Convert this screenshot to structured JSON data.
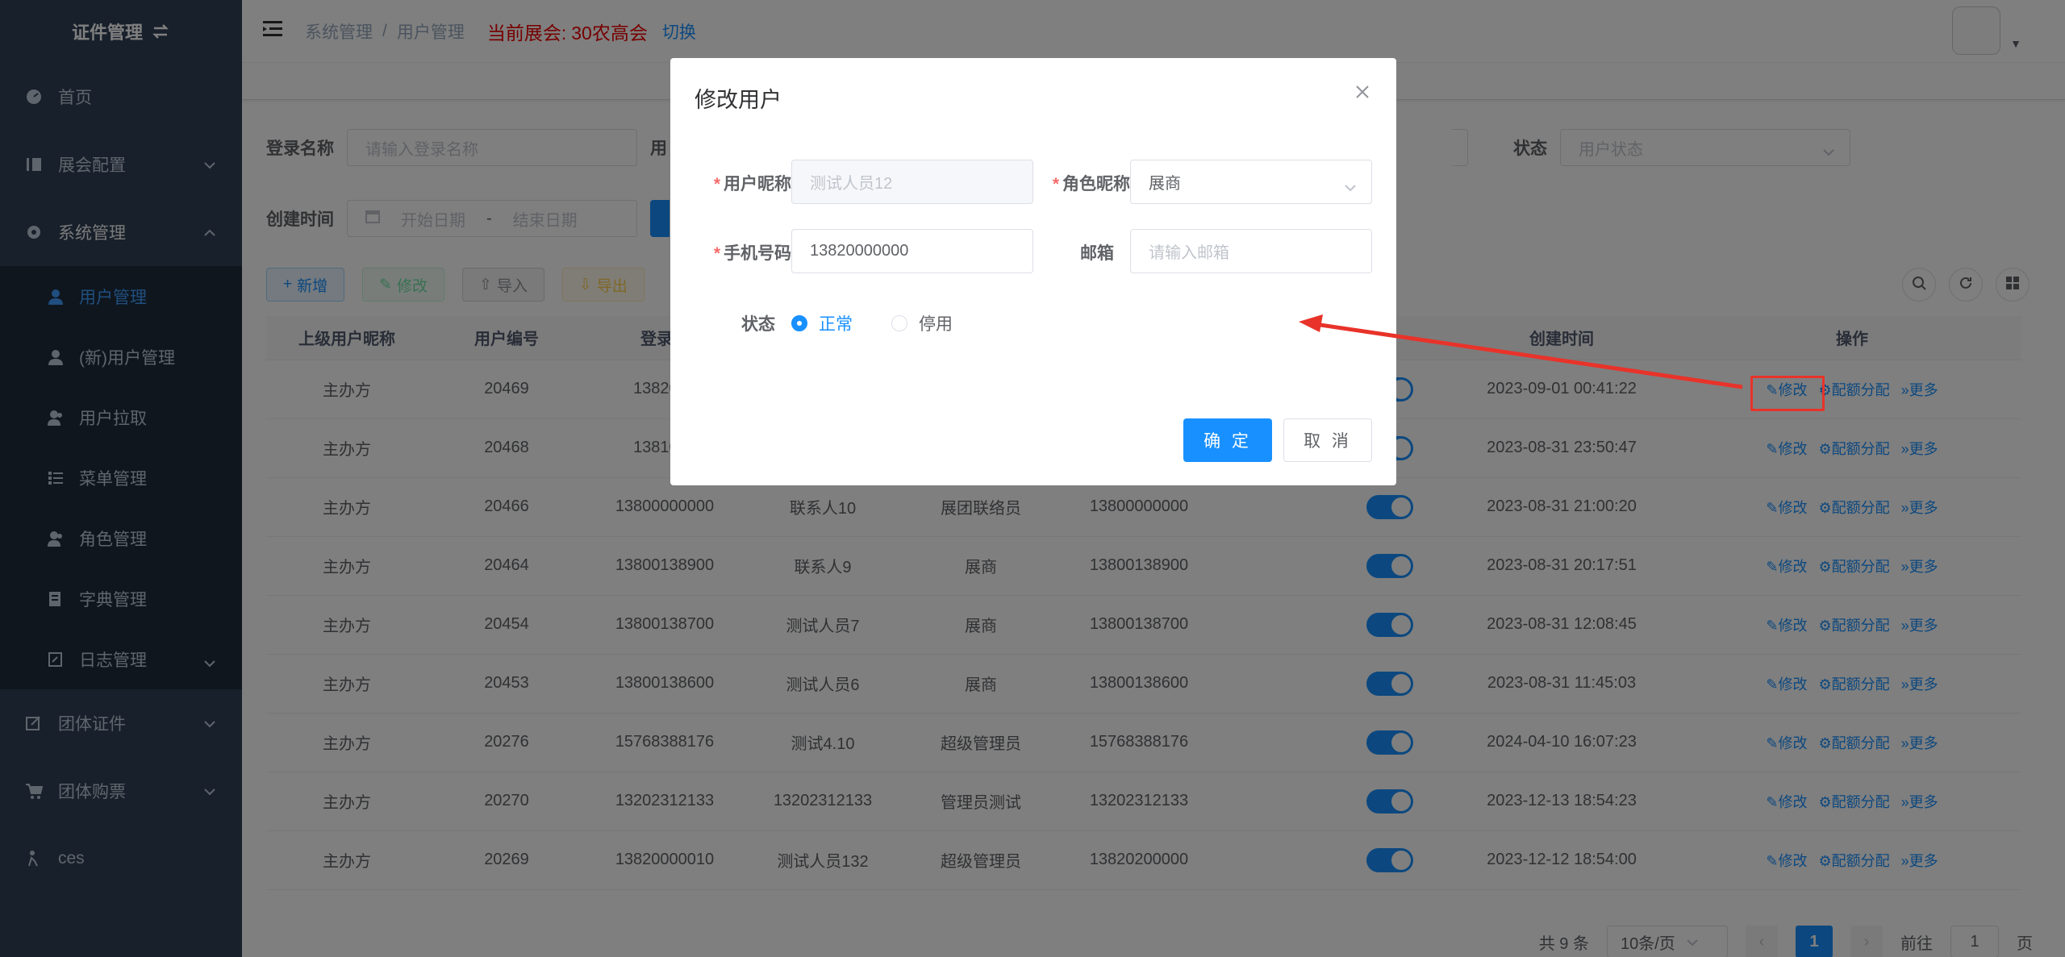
{
  "sidebar": {
    "title": "证件管理",
    "items": [
      {
        "label": "首页",
        "icon": "dashboard-icon"
      },
      {
        "label": "展会配置",
        "icon": "folder-icon"
      },
      {
        "label": "系统管理",
        "icon": "gear-icon"
      }
    ],
    "sub_items": [
      {
        "label": "用户管理",
        "icon": "user-icon",
        "active": true
      },
      {
        "label": "(新)用户管理",
        "icon": "user-icon"
      },
      {
        "label": "用户拉取",
        "icon": "peoples-icon"
      },
      {
        "label": "菜单管理",
        "icon": "tree-table-icon"
      },
      {
        "label": "角色管理",
        "icon": "peoples-icon"
      },
      {
        "label": "字典管理",
        "icon": "dict-icon"
      },
      {
        "label": "日志管理",
        "icon": "log-icon"
      }
    ],
    "bottom_items": [
      {
        "label": "团体证件",
        "icon": "edit-icon"
      },
      {
        "label": "团体购票",
        "icon": "cart-icon"
      },
      {
        "label": "ces",
        "icon": "user-wave-icon"
      }
    ]
  },
  "navbar": {
    "breadcrumb": [
      "系统管理",
      "/",
      "用户管理"
    ],
    "expo_label": "当前展会:",
    "expo_name": "30农高会",
    "switch": "切换"
  },
  "search": {
    "login_label": "登录名称",
    "login_placeholder": "请输入登录名称",
    "user_label": "用",
    "status_label": "状态",
    "status_placeholder": "用户状态",
    "created_label": "创建时间",
    "start_placeholder": "开始日期",
    "dash": "-",
    "end_placeholder": "结束日期"
  },
  "toolbar": {
    "add": "新增",
    "edit": "修改",
    "import": "导入",
    "export": "导出"
  },
  "table": {
    "headers": [
      "上级用户昵称",
      "用户编号",
      "登录名",
      "",
      "",
      "",
      "状态",
      "创建时间",
      "操作"
    ],
    "rows": [
      {
        "parent": "主办方",
        "id": "20469",
        "login": "1382000",
        "nick": "",
        "role": "",
        "phone": "",
        "created": "2023-09-01 00:41:22"
      },
      {
        "parent": "主办方",
        "id": "20468",
        "login": "1381000",
        "nick": "",
        "role": "",
        "phone": "",
        "created": "2023-08-31 23:50:47"
      },
      {
        "parent": "主办方",
        "id": "20466",
        "login": "13800000000",
        "nick": "联系人10",
        "role": "展团联络员",
        "phone": "13800000000",
        "created": "2023-08-31 21:00:20"
      },
      {
        "parent": "主办方",
        "id": "20464",
        "login": "13800138900",
        "nick": "联系人9",
        "role": "展商",
        "phone": "13800138900",
        "created": "2023-08-31 20:17:51"
      },
      {
        "parent": "主办方",
        "id": "20454",
        "login": "13800138700",
        "nick": "测试人员7",
        "role": "展商",
        "phone": "13800138700",
        "created": "2023-08-31 12:08:45"
      },
      {
        "parent": "主办方",
        "id": "20453",
        "login": "13800138600",
        "nick": "测试人员6",
        "role": "展商",
        "phone": "13800138600",
        "created": "2023-08-31 11:45:03"
      },
      {
        "parent": "主办方",
        "id": "20276",
        "login": "15768388176",
        "nick": "测试4.10",
        "role": "超级管理员",
        "phone": "15768388176",
        "created": "2024-04-10 16:07:23"
      },
      {
        "parent": "主办方",
        "id": "20270",
        "login": "13202312133",
        "nick": "13202312133",
        "role": "管理员测试",
        "phone": "13202312133",
        "created": "2023-12-13 18:54:23"
      },
      {
        "parent": "主办方",
        "id": "20269",
        "login": "13820000010",
        "nick": "测试人员132",
        "role": "超级管理员",
        "phone": "13820200000",
        "created": "2023-12-12 18:54:00"
      }
    ],
    "op_edit": "修改",
    "op_quota": "配额分配",
    "op_more": "更多"
  },
  "pager": {
    "total": "共 9 条",
    "size": "10条/页",
    "current": "1",
    "goto": "前往",
    "goto_value": "1",
    "page_unit": "页"
  },
  "dialog": {
    "title": "修改用户",
    "nick_label": "用户昵称",
    "nick_value": "测试人员12",
    "role_label": "角色昵称",
    "role_value": "展商",
    "phone_label": "手机号码",
    "phone_value": "13820000000",
    "email_label": "邮箱",
    "email_placeholder": "请输入邮箱",
    "status_label": "状态",
    "status_normal": "正常",
    "status_disabled": "停用",
    "ok": "确 定",
    "cancel": "取 消"
  },
  "colors": {
    "sidebar": "#304156",
    "primary": "#1890ff",
    "annotation": "#e8332a"
  }
}
